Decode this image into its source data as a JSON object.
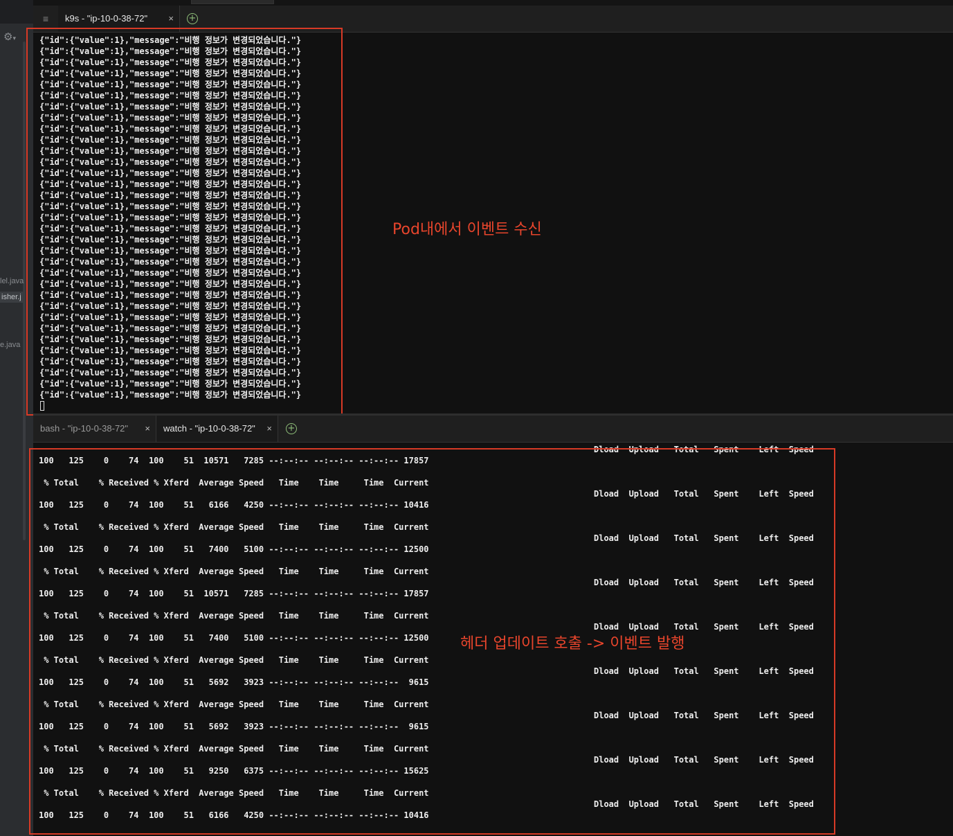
{
  "ide_sidebar": {
    "settings_icon": "gear-icon",
    "file_fragments": [
      "lel.java",
      "isher.j",
      "e.java"
    ]
  },
  "top_tabs": [
    {
      "label": "k9s - \"ip-10-0-38-72\"",
      "close": "×"
    }
  ],
  "bottom_tabs": [
    {
      "label": "bash - \"ip-10-0-38-72\"",
      "close": "×"
    },
    {
      "label": "watch - \"ip-10-0-38-72\"",
      "close": "×"
    }
  ],
  "new_tab_icon": "plus-circle-icon",
  "menu_icon": "hamburger-icon",
  "menu_glyph": "≡",
  "add_glyph": "+",
  "top_pane": {
    "lines": [
      "{\"id\":{\"value\":1},\"message\":\"비행 정보가 변경되었습니다.\"}",
      "{\"id\":{\"value\":1},\"message\":\"비행 정보가 변경되었습니다.\"}",
      "{\"id\":{\"value\":1},\"message\":\"비행 정보가 변경되었습니다.\"}",
      "{\"id\":{\"value\":1},\"message\":\"비행 정보가 변경되었습니다.\"}",
      "{\"id\":{\"value\":1},\"message\":\"비행 정보가 변경되었습니다.\"}",
      "{\"id\":{\"value\":1},\"message\":\"비행 정보가 변경되었습니다.\"}",
      "{\"id\":{\"value\":1},\"message\":\"비행 정보가 변경되었습니다.\"}",
      "{\"id\":{\"value\":1},\"message\":\"비행 정보가 변경되었습니다.\"}",
      "{\"id\":{\"value\":1},\"message\":\"비행 정보가 변경되었습니다.\"}",
      "{\"id\":{\"value\":1},\"message\":\"비행 정보가 변경되었습니다.\"}",
      "{\"id\":{\"value\":1},\"message\":\"비행 정보가 변경되었습니다.\"}",
      "{\"id\":{\"value\":1},\"message\":\"비행 정보가 변경되었습니다.\"}",
      "{\"id\":{\"value\":1},\"message\":\"비행 정보가 변경되었습니다.\"}",
      "{\"id\":{\"value\":1},\"message\":\"비행 정보가 변경되었습니다.\"}",
      "{\"id\":{\"value\":1},\"message\":\"비행 정보가 변경되었습니다.\"}",
      "{\"id\":{\"value\":1},\"message\":\"비행 정보가 변경되었습니다.\"}",
      "{\"id\":{\"value\":1},\"message\":\"비행 정보가 변경되었습니다.\"}",
      "{\"id\":{\"value\":1},\"message\":\"비행 정보가 변경되었습니다.\"}",
      "{\"id\":{\"value\":1},\"message\":\"비행 정보가 변경되었습니다.\"}",
      "{\"id\":{\"value\":1},\"message\":\"비행 정보가 변경되었습니다.\"}",
      "{\"id\":{\"value\":1},\"message\":\"비행 정보가 변경되었습니다.\"}",
      "{\"id\":{\"value\":1},\"message\":\"비행 정보가 변경되었습니다.\"}",
      "{\"id\":{\"value\":1},\"message\":\"비행 정보가 변경되었습니다.\"}",
      "{\"id\":{\"value\":1},\"message\":\"비행 정보가 변경되었습니다.\"}",
      "{\"id\":{\"value\":1},\"message\":\"비행 정보가 변경되었습니다.\"}",
      "{\"id\":{\"value\":1},\"message\":\"비행 정보가 변경되었습니다.\"}",
      "{\"id\":{\"value\":1},\"message\":\"비행 정보가 변경되었습니다.\"}",
      "{\"id\":{\"value\":1},\"message\":\"비행 정보가 변경되었습니다.\"}",
      "{\"id\":{\"value\":1},\"message\":\"비행 정보가 변경되었습니다.\"}",
      "{\"id\":{\"value\":1},\"message\":\"비행 정보가 변경되었습니다.\"}",
      "{\"id\":{\"value\":1},\"message\":\"비행 정보가 변경되었습니다.\"}",
      "{\"id\":{\"value\":1},\"message\":\"비행 정보가 변경되었습니다.\"}",
      "{\"id\":{\"value\":1},\"message\":\"비행 정보가 변경되었습니다.\"}"
    ],
    "annotation": "Pod내에서 이벤트 수신"
  },
  "bottom_pane": {
    "left_lines": [
      "100   125    0    74  100    51  10571   7285 --:--:-- --:--:-- --:--:-- 17857",
      " % Total    % Received % Xferd  Average Speed   Time    Time     Time  Current",
      "100   125    0    74  100    51   6166   4250 --:--:-- --:--:-- --:--:-- 10416",
      " % Total    % Received % Xferd  Average Speed   Time    Time     Time  Current",
      "100   125    0    74  100    51   7400   5100 --:--:-- --:--:-- --:--:-- 12500",
      " % Total    % Received % Xferd  Average Speed   Time    Time     Time  Current",
      "100   125    0    74  100    51  10571   7285 --:--:-- --:--:-- --:--:-- 17857",
      " % Total    % Received % Xferd  Average Speed   Time    Time     Time  Current",
      "100   125    0    74  100    51   7400   5100 --:--:-- --:--:-- --:--:-- 12500",
      " % Total    % Received % Xferd  Average Speed   Time    Time     Time  Current",
      "100   125    0    74  100    51   5692   3923 --:--:-- --:--:-- --:--:--  9615",
      " % Total    % Received % Xferd  Average Speed   Time    Time     Time  Current",
      "100   125    0    74  100    51   5692   3923 --:--:-- --:--:-- --:--:--  9615",
      " % Total    % Received % Xferd  Average Speed   Time    Time     Time  Current",
      "100   125    0    74  100    51   9250   6375 --:--:-- --:--:-- --:--:-- 15625",
      " % Total    % Received % Xferd  Average Speed   Time    Time     Time  Current",
      "100   125    0    74  100    51   6166   4250 --:--:-- --:--:-- --:--:-- 10416"
    ],
    "right_lines": [
      "Dload  Upload   Total   Spent    Left  Speed",
      "Dload  Upload   Total   Spent    Left  Speed",
      "Dload  Upload   Total   Spent    Left  Speed",
      "Dload  Upload   Total   Spent    Left  Speed",
      "Dload  Upload   Total   Spent    Left  Speed",
      "Dload  Upload   Total   Spent    Left  Speed",
      "Dload  Upload   Total   Spent    Left  Speed",
      "Dload  Upload   Total   Spent    Left  Speed",
      "Dload  Upload   Total   Spent    Left  Speed"
    ],
    "annotation": "헤더 업데이트 호출 -> 이벤트 발행"
  },
  "colors": {
    "annotation": "#e8452c",
    "terminal_bg": "#111111",
    "terminal_text": "#efefef",
    "add_icon": "#8fbf7a"
  }
}
